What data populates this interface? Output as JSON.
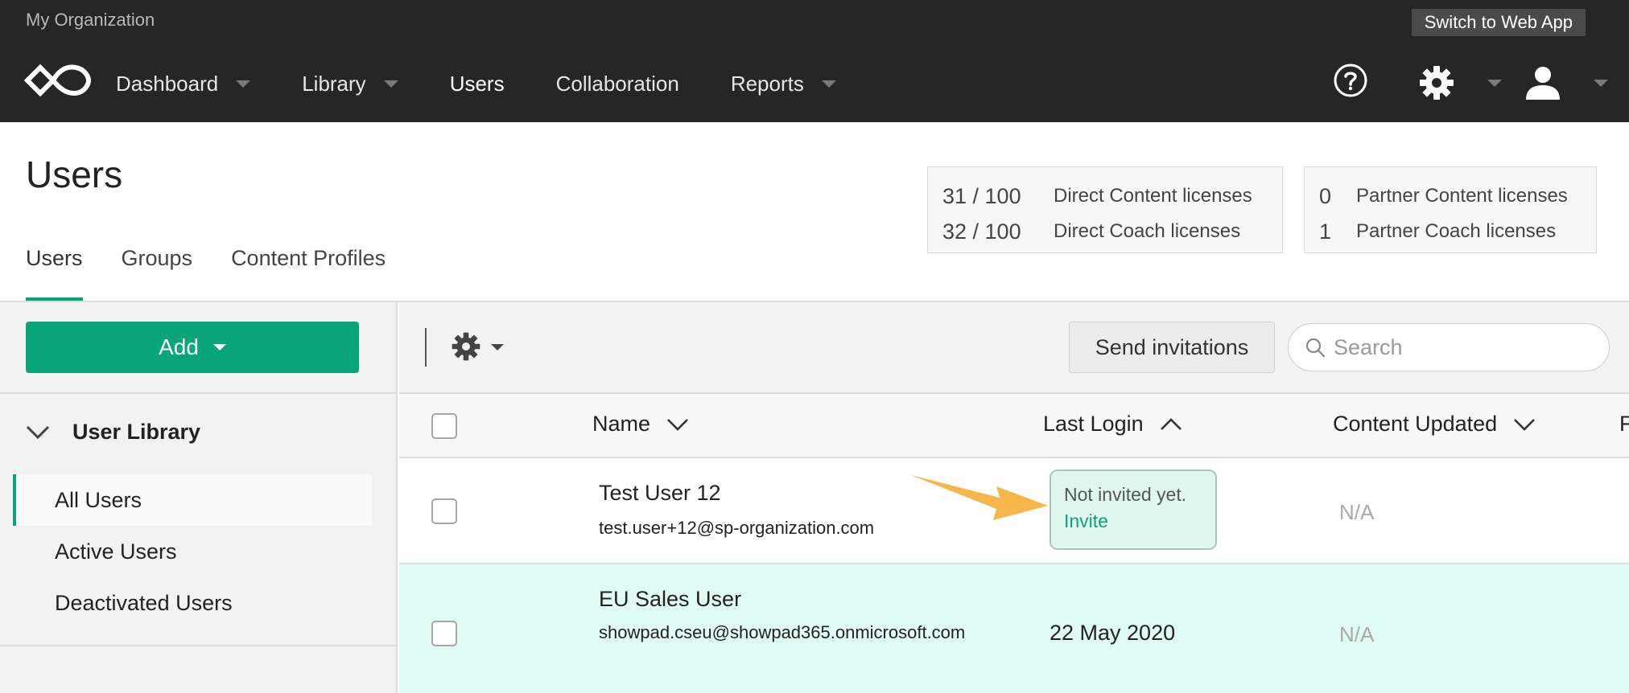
{
  "header": {
    "org_name": "My Organization",
    "switch_label": "Switch to Web App",
    "nav": [
      {
        "label": "Dashboard",
        "has_dropdown": true
      },
      {
        "label": "Library",
        "has_dropdown": true
      },
      {
        "label": "Users",
        "has_dropdown": false,
        "active": true
      },
      {
        "label": "Collaboration",
        "has_dropdown": false
      },
      {
        "label": "Reports",
        "has_dropdown": true
      }
    ]
  },
  "page": {
    "title": "Users",
    "tabs": [
      "Users",
      "Groups",
      "Content Profiles"
    ],
    "active_tab": "Users"
  },
  "licenses": {
    "direct": [
      {
        "count": "31 / 100",
        "label": "Direct Content licenses"
      },
      {
        "count": "32 / 100",
        "label": "Direct Coach licenses"
      }
    ],
    "partner": [
      {
        "count": "0",
        "label": "Partner Content licenses"
      },
      {
        "count": "1",
        "label": "Partner Coach licenses"
      }
    ]
  },
  "sidebar": {
    "add_label": "Add",
    "library_title": "User Library",
    "items": [
      "All Users",
      "Active Users",
      "Deactivated Users"
    ],
    "selected": "All Users"
  },
  "toolbar": {
    "send_label": "Send invitations",
    "search_placeholder": "Search"
  },
  "table": {
    "columns": [
      "Name",
      "Last Login",
      "Content Updated",
      "F"
    ],
    "rows": [
      {
        "name": "Test User 12",
        "email": "test.user+12@sp-organization.com",
        "last_login_status": "Not invited yet.",
        "last_login_action": "Invite",
        "content_updated": "N/A"
      },
      {
        "name": "EU Sales User",
        "email": "showpad.cseu@showpad365.onmicrosoft.com",
        "last_login": "22 May 2020",
        "content_updated": "N/A"
      }
    ]
  },
  "colors": {
    "accent": "#08a57a",
    "topbar": "#262626",
    "highlight_row": "#e0fbf4",
    "arrow": "#f6b64a"
  }
}
